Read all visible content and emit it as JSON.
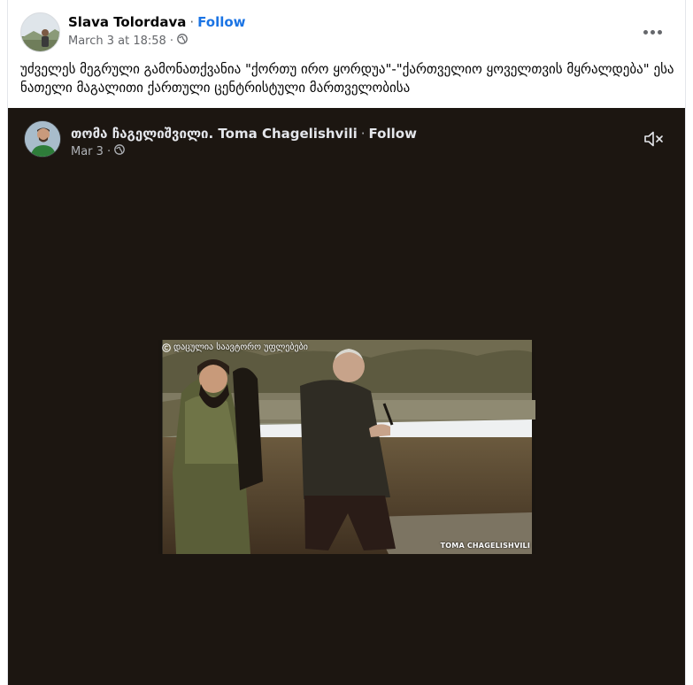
{
  "post": {
    "author": "Slava Tolordava",
    "follow_label": "Follow",
    "timestamp": "March 3 at 18:58",
    "privacy_icon": "globe-icon",
    "text": "უძველეს მეგრული გამონათქვანია \"ქორთუ ირო ყორდუა\"-\"ქართველიო ყოველთვის მყრალდება\" ესა ნათელი მაგალითი ქართული ცენტრისტული მართველობისა"
  },
  "shared": {
    "author": "თომა ჩაგელიშვილი. Toma Chagelishvili",
    "follow_label": "Follow",
    "date": "Mar 3",
    "privacy_icon": "globe-icon",
    "mute_icon": "speaker-muted-icon"
  },
  "video": {
    "watermark_top": "დაცულია საავტორო უფლებები",
    "watermark_bottom": "TOMA CHAGELISHVILI"
  },
  "colors": {
    "accent": "#1b74e4",
    "video_bg": "#1c1611"
  }
}
